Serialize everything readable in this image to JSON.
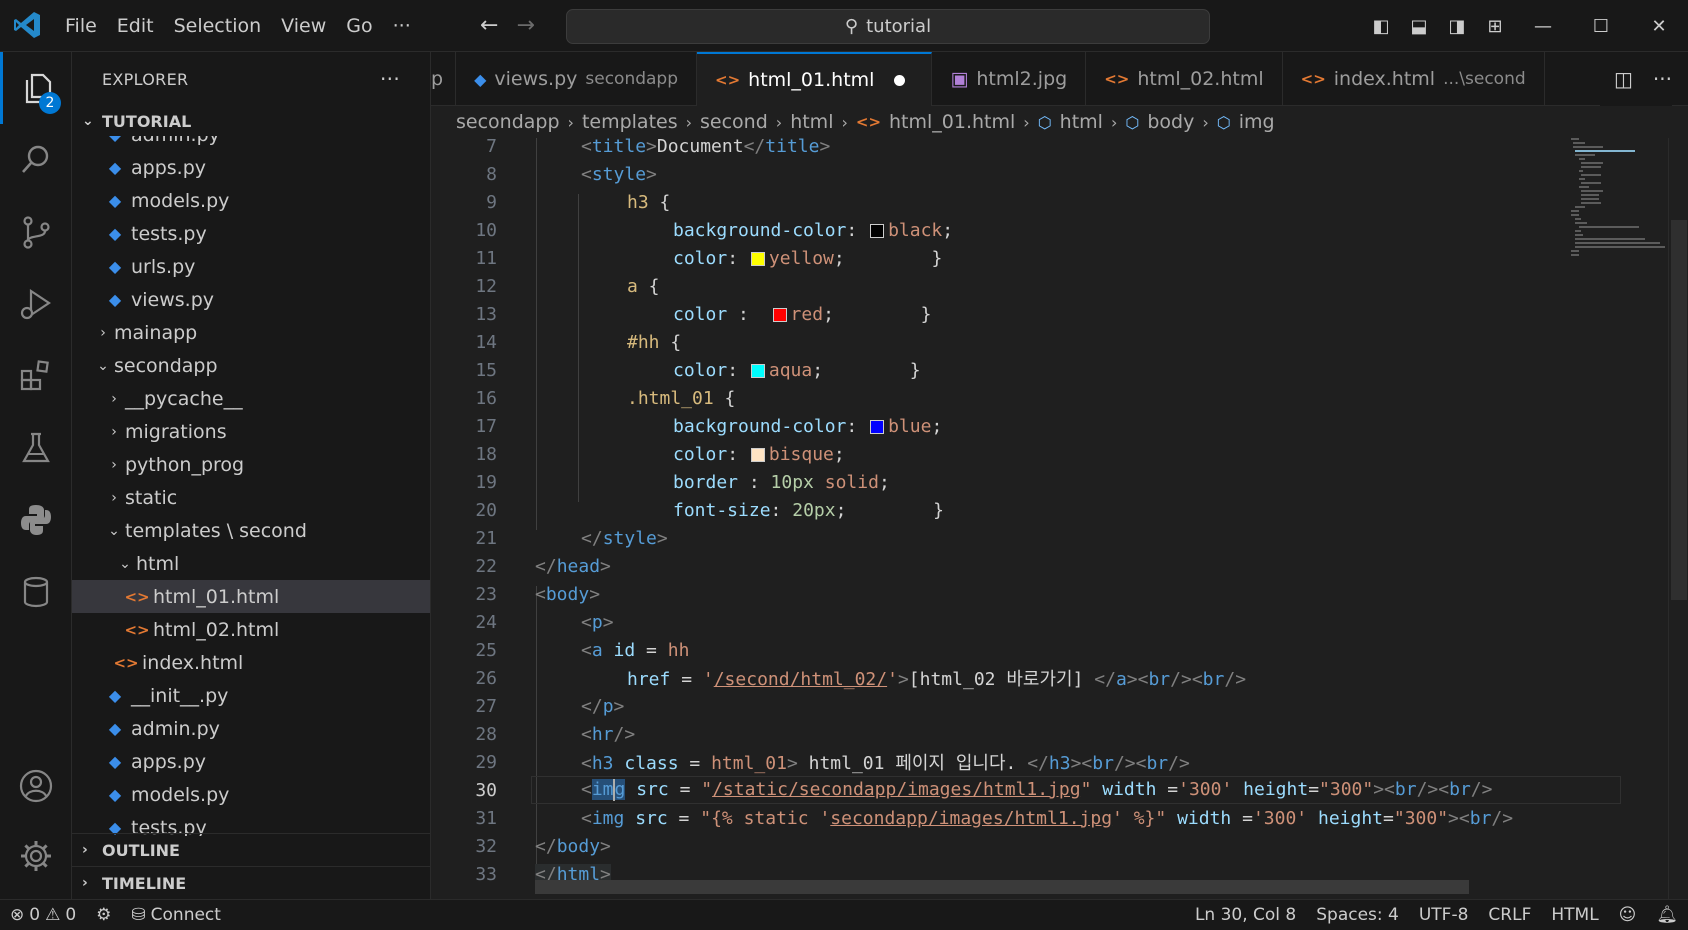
{
  "titlebar": {
    "menu": [
      "File",
      "Edit",
      "Selection",
      "View",
      "Go",
      "···"
    ],
    "search": "tutorial"
  },
  "activity": {
    "explorer_badge": "2"
  },
  "sidebar": {
    "title": "EXPLORER",
    "more": "···",
    "root": "TUTORIAL",
    "tree": [
      {
        "label": "admin.py",
        "type": "py",
        "indent": 1
      },
      {
        "label": "apps.py",
        "type": "py",
        "indent": 1
      },
      {
        "label": "models.py",
        "type": "py",
        "indent": 1
      },
      {
        "label": "tests.py",
        "type": "py",
        "indent": 1
      },
      {
        "label": "urls.py",
        "type": "py",
        "indent": 1
      },
      {
        "label": "views.py",
        "type": "py",
        "indent": 1
      },
      {
        "label": "mainapp",
        "type": "folder",
        "open": false,
        "indent": 0
      },
      {
        "label": "secondapp",
        "type": "folder",
        "open": true,
        "indent": 0
      },
      {
        "label": "__pycache__",
        "type": "folder",
        "open": false,
        "indent": 1
      },
      {
        "label": "migrations",
        "type": "folder",
        "open": false,
        "indent": 1
      },
      {
        "label": "python_prog",
        "type": "folder",
        "open": false,
        "indent": 1
      },
      {
        "label": "static",
        "type": "folder",
        "open": false,
        "indent": 1
      },
      {
        "label": "templates \\ second",
        "type": "folder",
        "open": true,
        "indent": 1
      },
      {
        "label": "html",
        "type": "folder",
        "open": true,
        "indent": 2
      },
      {
        "label": "html_01.html",
        "type": "html",
        "indent": 3,
        "selected": true
      },
      {
        "label": "html_02.html",
        "type": "html",
        "indent": 3
      },
      {
        "label": "index.html",
        "type": "html",
        "indent": 2
      },
      {
        "label": "__init__.py",
        "type": "py",
        "indent": 1
      },
      {
        "label": "admin.py",
        "type": "py",
        "indent": 1
      },
      {
        "label": "apps.py",
        "type": "py",
        "indent": 1
      },
      {
        "label": "models.py",
        "type": "py",
        "indent": 1
      },
      {
        "label": "tests.py",
        "type": "py",
        "indent": 1
      }
    ],
    "outline": "OUTLINE",
    "timeline": "TIMELINE"
  },
  "tabs": [
    {
      "label": "p",
      "desc": "",
      "icon": "none",
      "partial": true
    },
    {
      "label": "views.py",
      "desc": "secondapp",
      "icon": "py"
    },
    {
      "label": "html_01.html",
      "desc": "",
      "icon": "html",
      "active": true,
      "dirty": true
    },
    {
      "label": "html2.jpg",
      "desc": "",
      "icon": "img"
    },
    {
      "label": "html_02.html",
      "desc": "",
      "icon": "html"
    },
    {
      "label": "index.html",
      "desc": "...\\second",
      "icon": "html"
    }
  ],
  "breadcrumb": [
    "secondapp",
    "templates",
    "second",
    "html",
    "html_01.html",
    "html",
    "body",
    "img"
  ],
  "editor": {
    "current_line": 30,
    "line_numbers": [
      "7",
      "8",
      "9",
      "10",
      "11",
      "12",
      "13",
      "14",
      "15",
      "16",
      "17",
      "18",
      "19",
      "20",
      "21",
      "22",
      "23",
      "24",
      "25",
      "26",
      "27",
      "28",
      "29",
      "30",
      "31",
      "32",
      "33"
    ]
  },
  "swatches": {
    "black": "#000000",
    "yellow": "#ffff00",
    "red": "#ff0000",
    "aqua": "#00ffff",
    "blue": "#0000ff",
    "bisque": "#ffe4c4"
  },
  "statusbar": {
    "errors": "0",
    "warnings": "0",
    "connect": "Connect",
    "position": "Ln 30, Col 8",
    "spaces": "Spaces: 4",
    "encoding": "UTF-8",
    "eol": "CRLF",
    "language": "HTML"
  }
}
